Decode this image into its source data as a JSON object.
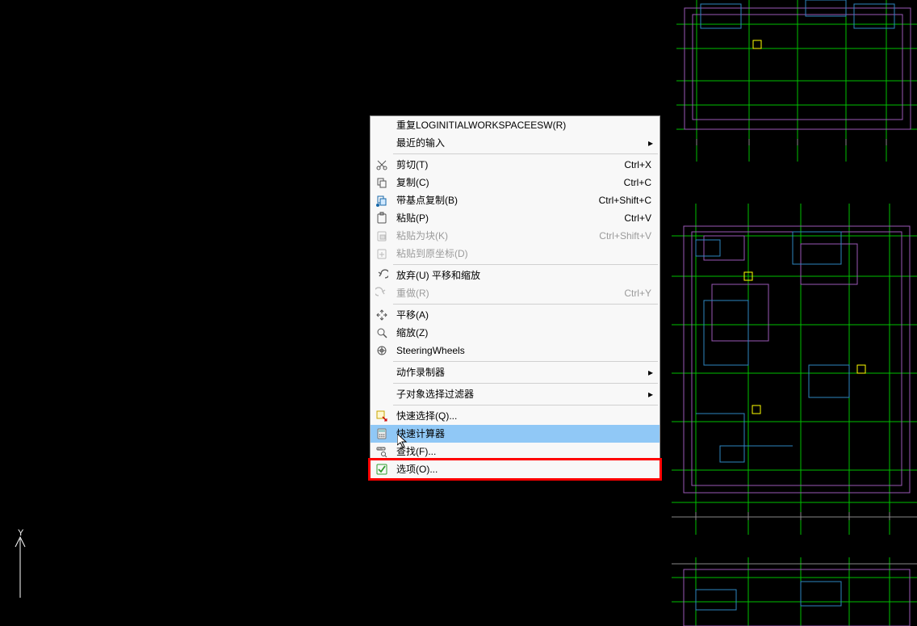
{
  "menu": {
    "items": [
      {
        "id": "repeat",
        "label": "重复LOGINITIALWORKSPACEESW(R)",
        "shortcut": "",
        "icon": "",
        "submenu": false,
        "disabled": false
      },
      {
        "id": "recent-input",
        "label": "最近的输入",
        "shortcut": "",
        "icon": "",
        "submenu": true,
        "disabled": false
      },
      {
        "sep": true
      },
      {
        "id": "cut",
        "label": "剪切(T)",
        "shortcut": "Ctrl+X",
        "icon": "scissors-icon",
        "submenu": false,
        "disabled": false
      },
      {
        "id": "copy",
        "label": "复制(C)",
        "shortcut": "Ctrl+C",
        "icon": "copy-icon",
        "submenu": false,
        "disabled": false
      },
      {
        "id": "copy-base",
        "label": "带基点复制(B)",
        "shortcut": "Ctrl+Shift+C",
        "icon": "copy-base-icon",
        "submenu": false,
        "disabled": false
      },
      {
        "id": "paste",
        "label": "粘贴(P)",
        "shortcut": "Ctrl+V",
        "icon": "paste-icon",
        "submenu": false,
        "disabled": false
      },
      {
        "id": "paste-block",
        "label": "粘贴为块(K)",
        "shortcut": "Ctrl+Shift+V",
        "icon": "paste-block-icon",
        "submenu": false,
        "disabled": true
      },
      {
        "id": "paste-orig",
        "label": "粘贴到原坐标(D)",
        "shortcut": "",
        "icon": "paste-orig-icon",
        "submenu": false,
        "disabled": true
      },
      {
        "sep": true
      },
      {
        "id": "undo",
        "label": "放弃(U) 平移和缩放",
        "shortcut": "",
        "icon": "undo-icon",
        "submenu": false,
        "disabled": false
      },
      {
        "id": "redo",
        "label": "重做(R)",
        "shortcut": "Ctrl+Y",
        "icon": "redo-icon",
        "submenu": false,
        "disabled": true
      },
      {
        "sep": true
      },
      {
        "id": "pan",
        "label": "平移(A)",
        "shortcut": "",
        "icon": "pan-icon",
        "submenu": false,
        "disabled": false
      },
      {
        "id": "zoom",
        "label": "缩放(Z)",
        "shortcut": "",
        "icon": "zoom-icon",
        "submenu": false,
        "disabled": false
      },
      {
        "id": "wheels",
        "label": "SteeringWheels",
        "shortcut": "",
        "icon": "wheel-icon",
        "submenu": false,
        "disabled": false
      },
      {
        "sep": true
      },
      {
        "id": "action-rec",
        "label": "动作录制器",
        "shortcut": "",
        "icon": "",
        "submenu": true,
        "disabled": false
      },
      {
        "sep": true
      },
      {
        "id": "subobj-filter",
        "label": "子对象选择过滤器",
        "shortcut": "",
        "icon": "",
        "submenu": true,
        "disabled": false
      },
      {
        "sep": true
      },
      {
        "id": "qselect",
        "label": "快速选择(Q)...",
        "shortcut": "",
        "icon": "qselect-icon",
        "submenu": false,
        "disabled": false
      },
      {
        "id": "qcalc",
        "label": "快速计算器",
        "shortcut": "",
        "icon": "calc-icon",
        "submenu": false,
        "disabled": false,
        "highlight": true
      },
      {
        "id": "find",
        "label": "查找(F)...",
        "shortcut": "",
        "icon": "find-icon",
        "submenu": false,
        "disabled": false
      },
      {
        "id": "options",
        "label": "选项(O)...",
        "shortcut": "",
        "icon": "check-icon",
        "submenu": false,
        "disabled": false,
        "redbox": true
      }
    ]
  },
  "ucs": {
    "label_y": "Y"
  }
}
